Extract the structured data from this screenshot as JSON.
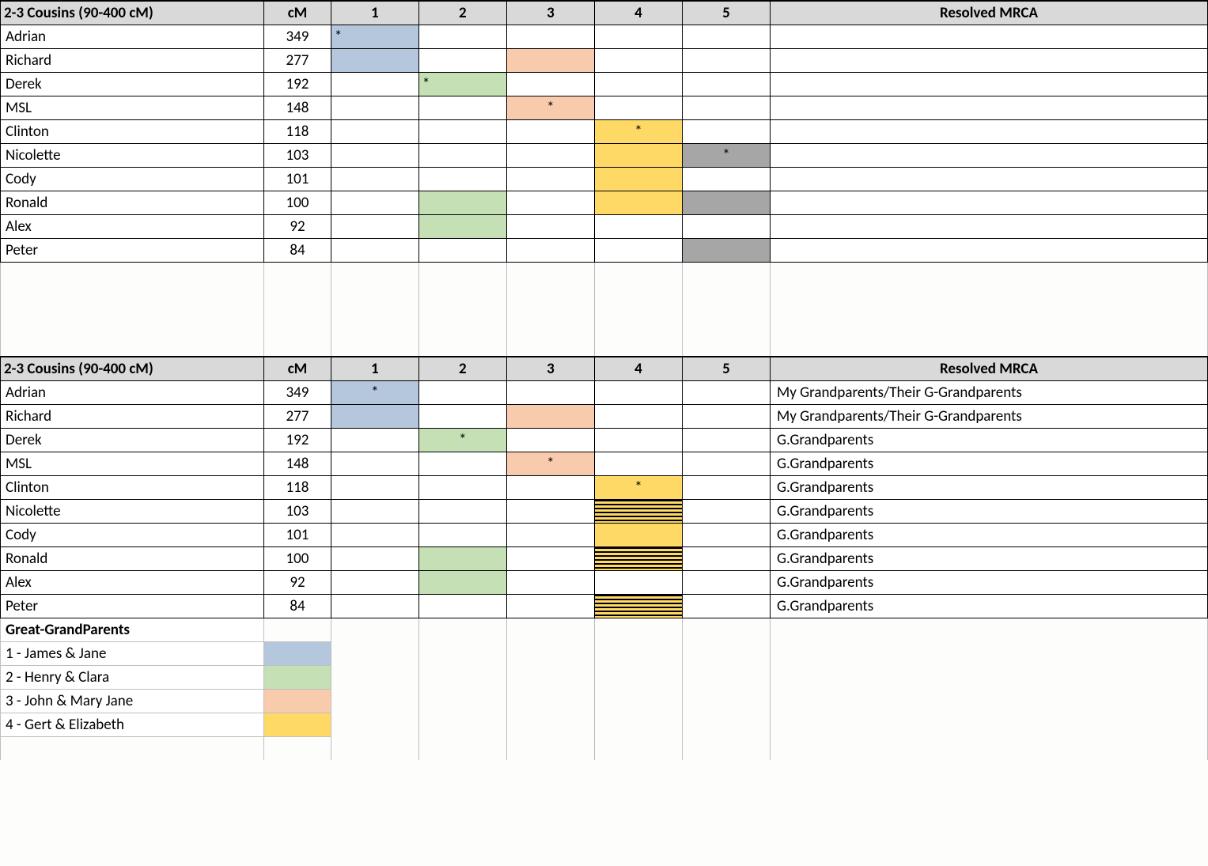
{
  "headers": {
    "title": "2-3 Cousins  (90-400 cM)",
    "cm": "cM",
    "g1": "1",
    "g2": "2",
    "g3": "3",
    "g4": "4",
    "g5": "5",
    "mrca": "Resolved MRCA"
  },
  "colors": {
    "blue": "#b4c7dc",
    "green": "#c5e0b4",
    "salmon": "#f8cbad",
    "yellow": "#ffd966",
    "gray": "#a6a6a6"
  },
  "table1": [
    {
      "name": "Adrian",
      "cm": "349",
      "cells": [
        {
          "c": "blue",
          "t": "*",
          "left": true
        },
        {},
        {},
        {},
        {}
      ],
      "mrca": ""
    },
    {
      "name": "Richard",
      "cm": "277",
      "cells": [
        {
          "c": "blue"
        },
        {},
        {
          "c": "salmon"
        },
        {},
        {}
      ],
      "mrca": ""
    },
    {
      "name": "Derek",
      "cm": "192",
      "cells": [
        {},
        {
          "c": "green",
          "t": "*",
          "left": true
        },
        {},
        {},
        {}
      ],
      "mrca": ""
    },
    {
      "name": "MSL",
      "cm": "148",
      "cells": [
        {},
        {},
        {
          "c": "salmon",
          "t": "*"
        },
        {},
        {}
      ],
      "mrca": ""
    },
    {
      "name": "Clinton",
      "cm": "118",
      "cells": [
        {},
        {},
        {},
        {
          "c": "yellow",
          "t": "*"
        },
        {}
      ],
      "mrca": ""
    },
    {
      "name": "Nicolette",
      "cm": "103",
      "cells": [
        {},
        {},
        {},
        {
          "c": "yellow"
        },
        {
          "c": "gray",
          "t": "*"
        }
      ],
      "mrca": ""
    },
    {
      "name": "Cody",
      "cm": "101",
      "cells": [
        {},
        {},
        {},
        {
          "c": "yellow"
        },
        {}
      ],
      "mrca": ""
    },
    {
      "name": "Ronald",
      "cm": "100",
      "cells": [
        {},
        {
          "c": "green"
        },
        {},
        {
          "c": "yellow"
        },
        {
          "c": "gray"
        }
      ],
      "mrca": ""
    },
    {
      "name": "Alex",
      "cm": "92",
      "cells": [
        {},
        {
          "c": "green"
        },
        {},
        {},
        {}
      ],
      "mrca": ""
    },
    {
      "name": "Peter",
      "cm": "84",
      "cells": [
        {},
        {},
        {},
        {},
        {
          "c": "gray"
        }
      ],
      "mrca": ""
    }
  ],
  "table2": [
    {
      "name": "Adrian",
      "cm": "349",
      "cells": [
        {
          "c": "blue",
          "t": "*"
        },
        {},
        {},
        {},
        {}
      ],
      "mrca": " My Grandparents/Their G-Grandparents"
    },
    {
      "name": "Richard",
      "cm": "277",
      "cells": [
        {
          "c": "blue"
        },
        {},
        {
          "c": "salmon"
        },
        {},
        {}
      ],
      "mrca": " My Grandparents/Their G-Grandparents"
    },
    {
      "name": "Derek",
      "cm": "192",
      "cells": [
        {},
        {
          "c": "green",
          "t": "*"
        },
        {},
        {},
        {}
      ],
      "mrca": "G.Grandparents"
    },
    {
      "name": "MSL",
      "cm": "148",
      "cells": [
        {},
        {},
        {
          "c": "salmon",
          "t": "*"
        },
        {},
        {}
      ],
      "mrca": "G.Grandparents"
    },
    {
      "name": "Clinton",
      "cm": "118",
      "cells": [
        {},
        {},
        {},
        {
          "c": "yellow",
          "t": "*"
        },
        {}
      ],
      "mrca": "G.Grandparents"
    },
    {
      "name": "Nicolette",
      "cm": "103",
      "cells": [
        {},
        {},
        {},
        {
          "c": "hatched"
        },
        {}
      ],
      "mrca": "G.Grandparents"
    },
    {
      "name": "Cody",
      "cm": "101",
      "cells": [
        {},
        {},
        {},
        {
          "c": "yellow"
        },
        {}
      ],
      "mrca": "G.Grandparents"
    },
    {
      "name": "Ronald",
      "cm": "100",
      "cells": [
        {},
        {
          "c": "green"
        },
        {},
        {
          "c": "hatched"
        },
        {}
      ],
      "mrca": "G.Grandparents"
    },
    {
      "name": "Alex",
      "cm": "92",
      "cells": [
        {},
        {
          "c": "green"
        },
        {},
        {},
        {}
      ],
      "mrca": "G.Grandparents"
    },
    {
      "name": "Peter",
      "cm": "84",
      "cells": [
        {},
        {},
        {},
        {
          "c": "hatched"
        },
        {}
      ],
      "mrca": "G.Grandparents"
    }
  ],
  "legend": {
    "title": "Great-GrandParents",
    "items": [
      {
        "label": "1 - James & Jane",
        "color": "blue"
      },
      {
        "label": "2 - Henry & Clara",
        "color": "green"
      },
      {
        "label": "3 - John & Mary Jane",
        "color": "salmon"
      },
      {
        "label": "4 - Gert & Elizabeth",
        "color": "yellow"
      }
    ]
  }
}
